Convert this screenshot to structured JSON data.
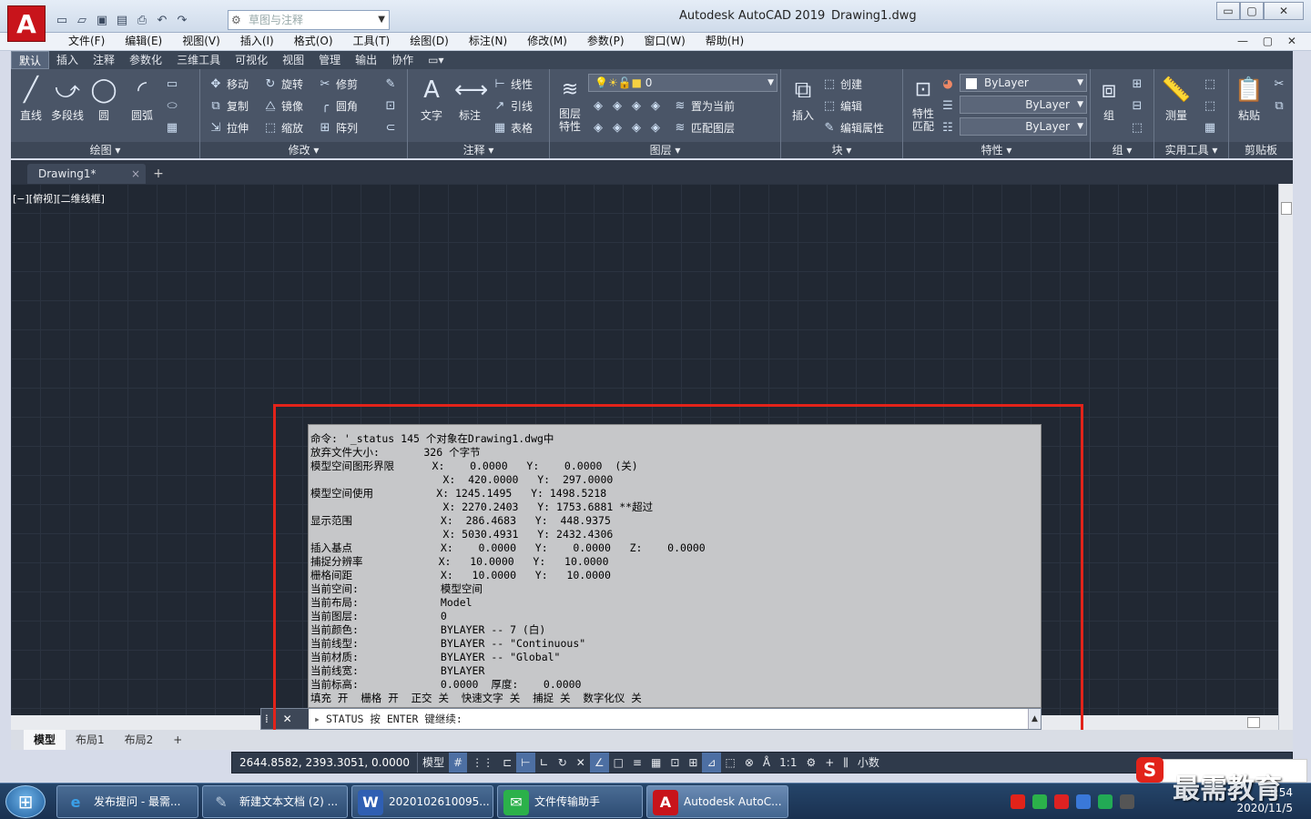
{
  "titlebar": {
    "app_title": "Autodesk AutoCAD 2019",
    "doc_name": "Drawing1.dwg",
    "workspace_placeholder": "草图与注释",
    "logo_letter": "A",
    "min": "▭",
    "max": "▢",
    "close": "✕"
  },
  "menubar": {
    "items": [
      "文件(F)",
      "编辑(E)",
      "视图(V)",
      "插入(I)",
      "格式(O)",
      "工具(T)",
      "绘图(D)",
      "标注(N)",
      "修改(M)",
      "参数(P)",
      "窗口(W)",
      "帮助(H)"
    ],
    "mdi": "— ▢ ✕"
  },
  "ribbon_tabs": [
    "默认",
    "插入",
    "注释",
    "参数化",
    "三维工具",
    "可视化",
    "视图",
    "管理",
    "输出",
    "协作"
  ],
  "ribbon_extra": "▭▾",
  "ribbon": {
    "draw": {
      "line": "直线",
      "polyline": "多段线",
      "circle": "圆",
      "arc": "圆弧",
      "title": "绘图 ▾"
    },
    "modify": {
      "move": "移动",
      "rotate": "旋转",
      "trim": "修剪",
      "copy": "复制",
      "mirror": "镜像",
      "fillet": "圆角",
      "stretch": "拉伸",
      "scale": "缩放",
      "array": "阵列",
      "title": "修改 ▾"
    },
    "annotation": {
      "text": "文字",
      "dim": "标注",
      "linear": "线性",
      "leader": "引线",
      "table": "表格",
      "title": "注释 ▾"
    },
    "layers": {
      "props_line1": "图层",
      "props_line2": "特性",
      "current_layer": "0",
      "make_current": "置为当前",
      "match_layer": "匹配图层",
      "title": "图层 ▾"
    },
    "block": {
      "insert": "插入",
      "create": "创建",
      "edit": "编辑",
      "edit_attr": "编辑属性",
      "title": "块 ▾"
    },
    "properties": {
      "match_line1": "特性",
      "match_line2": "匹配",
      "color": "ByLayer",
      "linetype": "ByLayer",
      "lineweight": "ByLayer",
      "title": "特性 ▾"
    },
    "group": {
      "group": "组",
      "title": "组 ▾"
    },
    "utilities": {
      "measure": "测量",
      "title": "实用工具 ▾"
    },
    "clipboard": {
      "paste": "粘贴",
      "title": "剪贴板"
    }
  },
  "doc_tab": {
    "label": "Drawing1*",
    "close": "×",
    "new": "+"
  },
  "view_label": "[−][俯视][二维线框]",
  "text_window": {
    "lines": [
      "命令: '_status 145 个对象在Drawing1.dwg中",
      "放弃文件大小:       326 个字节",
      "模型空间图形界限      X:    0.0000   Y:    0.0000  (关)",
      "                     X:  420.0000   Y:  297.0000",
      "模型空间使用          X: 1245.1495   Y: 1498.5218",
      "                     X: 2270.2403   Y: 1753.6881 **超过",
      "显示范围              X:  286.4683   Y:  448.9375",
      "                     X: 5030.4931   Y: 2432.4306",
      "插入基点              X:    0.0000   Y:    0.0000   Z:    0.0000",
      "捕捉分辨率            X:   10.0000   Y:   10.0000",
      "栅格间距              X:   10.0000   Y:   10.0000",
      "当前空间:             模型空间",
      "当前布局:             Model",
      "当前图层:             0",
      "当前颜色:             BYLAYER -- 7 (白)",
      "当前线型:             BYLAYER -- \"Continuous\"",
      "当前材质:             BYLAYER -- \"Global\"",
      "当前线宽:             BYLAYER",
      "当前标高:             0.0000  厚度:    0.0000",
      "填充 开  栅格 开  正交 关  快速文字 关  捕捉 关  数字化仪 关"
    ]
  },
  "command_line": {
    "grip": "⁞ ✕ 🔧",
    "prompt_icon": "▸",
    "prompt": "STATUS 按 ENTER 键继续:",
    "scroll": "▲"
  },
  "layout_tabs": [
    "模型",
    "布局1",
    "布局2",
    "+"
  ],
  "statusbar": {
    "coords": "2644.8582, 2393.3051, 0.0000",
    "model": "模型",
    "scale": "1:1",
    "units": "小数",
    "buttons": [
      "#",
      "⋮⋮",
      "⊏",
      "⊢",
      "∟",
      "↻",
      "✕",
      "∠",
      "□",
      "≡",
      "▦",
      "⊡",
      "⊞",
      "⊿",
      "⬚",
      "⊗",
      "Å",
      "⚙",
      "+",
      "⫼"
    ]
  },
  "taskbar": {
    "start": "⊞",
    "items": [
      {
        "icon": "e",
        "label": "发布提问 - 最需..."
      },
      {
        "icon": "✎",
        "label": "新建文本文档 (2) ..."
      },
      {
        "icon": "W",
        "label": "2020102610095..."
      },
      {
        "icon": "✉",
        "label": "文件传输助手"
      },
      {
        "icon": "A",
        "label": "Autodesk AutoC..."
      }
    ],
    "time": "1:54",
    "date": "2020/11/5"
  },
  "watermark": "最需教育",
  "watermark_logo": "S",
  "colors": {
    "accent": "#c8141b",
    "highlight_box": "#e2231a",
    "canvas": "#212833",
    "ribbon": "#4a5567"
  }
}
